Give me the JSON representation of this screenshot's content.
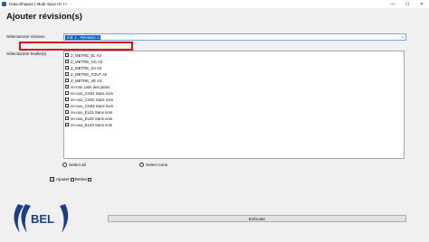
{
  "window": {
    "title": "Data-Shapes | Multi Input UI ++"
  },
  "window_controls": {
    "minimize": "—",
    "maximize": "☐",
    "close": "✕"
  },
  "page": {
    "heading": "Ajouter révision(s)"
  },
  "revision": {
    "label": "Sélectionner révision",
    "selected": "Ind. 1 - Révision 1"
  },
  "sheets": {
    "label": "Sélectionner feuille(s)",
    "items": [
      "Z_METRE_EL A3",
      "Z_METRE_GC A3",
      "Z_METRE_SA A3",
      "Z_METRE_TOUT A0",
      "Z_METRE_VE A3",
      "nn-nnn Liste des plans",
      "nn-ooo_CS01 Sans nom",
      "nn-ooo_CS02 Sans nom",
      "nn-ooo_CS03 Sans nom",
      "nn-ooo_EL01 Sans nom",
      "nn-ooo_EL02 Sans nom",
      "nn-ooo_EL03 Sans nom"
    ]
  },
  "selection": {
    "select_all": "Select all",
    "select_none": "Select none"
  },
  "options": {
    "ajouter": "Ajouter",
    "retirer": "Retirer"
  },
  "logo": {
    "text": "BEL"
  },
  "actions": {
    "execute": "Exécuter"
  }
}
